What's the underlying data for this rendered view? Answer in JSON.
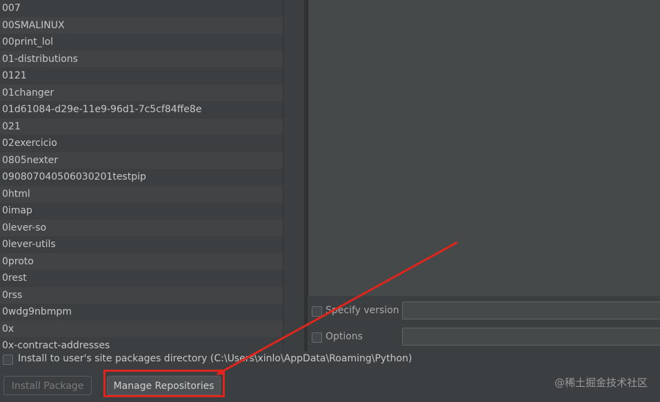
{
  "packages": [
    "007",
    "00SMALINUX",
    "00print_lol",
    "01-distributions",
    "0121",
    "01changer",
    "01d61084-d29e-11e9-96d1-7c5cf84ffe8e",
    "021",
    "02exercicio",
    "0805nexter",
    "090807040506030201testpip",
    "0html",
    "0imap",
    "0lever-so",
    "0lever-utils",
    "0proto",
    "0rest",
    "0rss",
    "0wdg9nbmpm",
    "0x",
    "0x-contract-addresses"
  ],
  "options": {
    "specify_version_label": "Specify version",
    "options_label": "Options"
  },
  "install_user": {
    "label": "Install to user's site packages directory (C:\\Users\\xinlo\\AppData\\Roaming\\Python)"
  },
  "buttons": {
    "install_label": "Install Package",
    "manage_label": "Manage Repositories"
  },
  "watermark": "@稀土掘金技术社区",
  "colors": {
    "annotation": "#e0251c",
    "background": "#3c3f41"
  }
}
